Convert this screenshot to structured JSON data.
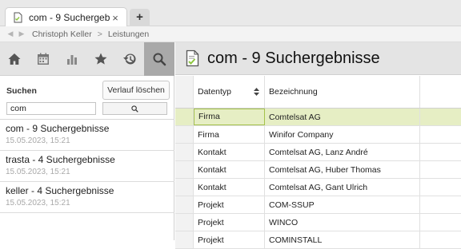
{
  "tab": {
    "title": "com - 9 Suchergebnisse",
    "close": "×",
    "new_tab": "+"
  },
  "breadcrumb": {
    "back": "◀",
    "forward": "▶",
    "items": [
      "Christoph Keller",
      "Leistungen"
    ],
    "separator": ">"
  },
  "toolbar": {
    "buttons": [
      {
        "icon": "home-icon"
      },
      {
        "icon": "calendar-icon"
      },
      {
        "icon": "chart-icon"
      },
      {
        "icon": "star-icon"
      },
      {
        "icon": "history-icon"
      },
      {
        "icon": "search-icon",
        "active": true
      }
    ]
  },
  "search": {
    "label": "Suchen",
    "clear_button": "Verlauf löschen",
    "input_value": "com"
  },
  "history": [
    {
      "title": "com - 9 Suchergebnisse",
      "date": "15.05.2023, 15:21"
    },
    {
      "title": "trasta - 4 Suchergebnisse",
      "date": "15.05.2023, 15:21"
    },
    {
      "title": "keller - 4 Suchergebnisse",
      "date": "15.05.2023, 15:21"
    }
  ],
  "main": {
    "title": "com - 9 Suchergebnisse",
    "columns": [
      "Datentyp",
      "Bezeichnung"
    ],
    "rows": [
      {
        "type": "Firma",
        "name": "Comtelsat AG",
        "selected": true
      },
      {
        "type": "Firma",
        "name": "Winifor Company"
      },
      {
        "type": "Kontakt",
        "name": "Comtelsat AG, Lanz André"
      },
      {
        "type": "Kontakt",
        "name": "Comtelsat AG, Huber Thomas"
      },
      {
        "type": "Kontakt",
        "name": "Comtelsat AG, Gant Ulrich"
      },
      {
        "type": "Projekt",
        "name": "COM-SSUP"
      },
      {
        "type": "Projekt",
        "name": "WINCO"
      },
      {
        "type": "Projekt",
        "name": "COMINSTALL"
      }
    ]
  },
  "colors": {
    "accent": "#8dc63f",
    "selected_row": "#e6eec4",
    "selected_border": "#a4c24a",
    "toolbar_bg": "#e4e4e4"
  }
}
